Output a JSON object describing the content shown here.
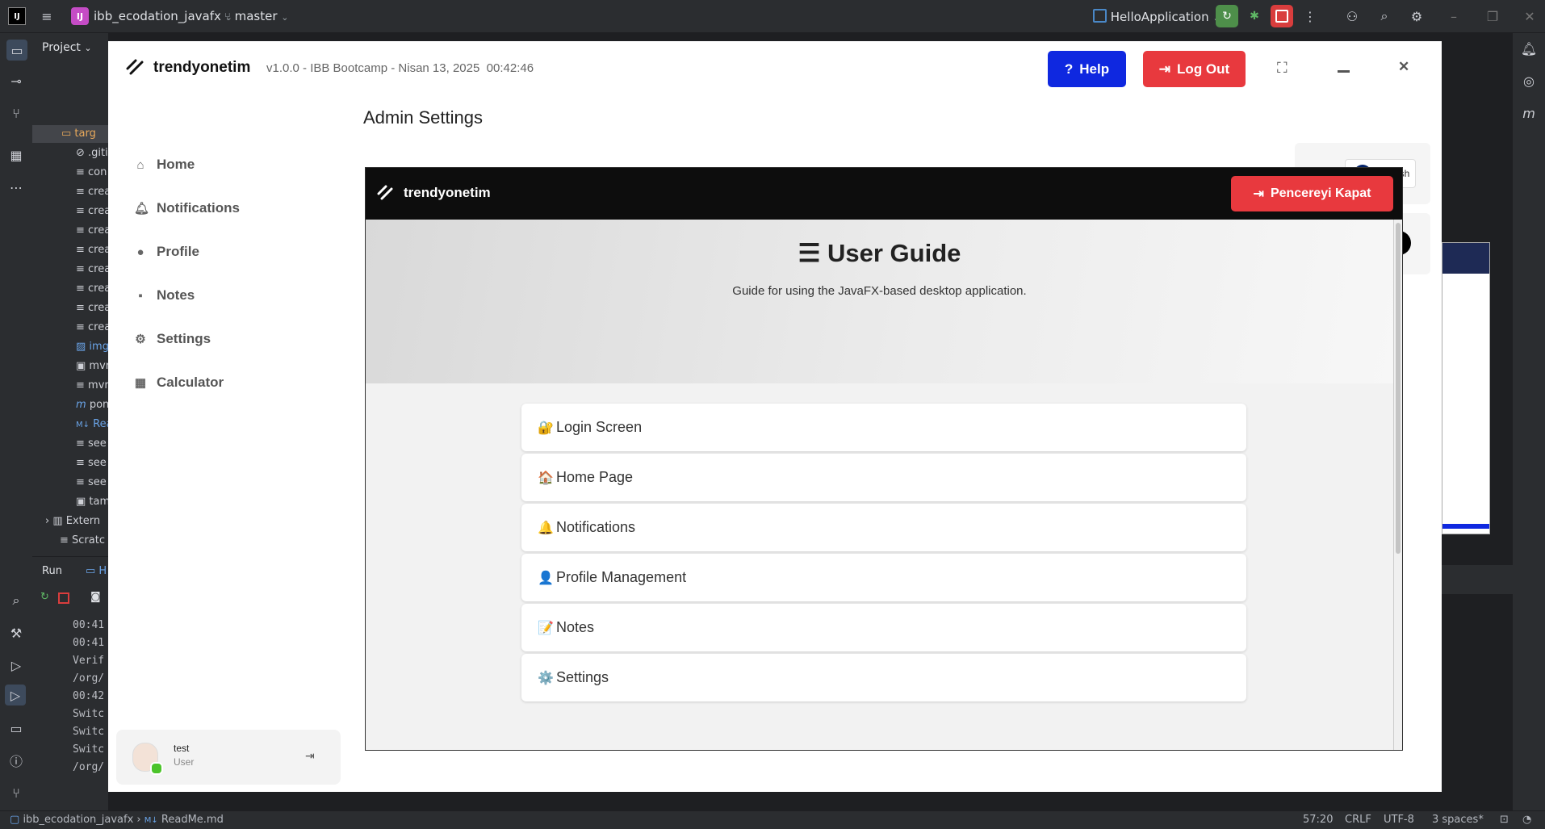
{
  "ide": {
    "project_name": "ibb_ecodation_javafx",
    "project_badge": "IJ",
    "branch": "master",
    "run_config": "HelloApplication",
    "project_panel_label": "Project",
    "tree": [
      "targ",
      ".giti",
      "con",
      "crea",
      "crea",
      "crea",
      "crea",
      "crea",
      "crea",
      "crea",
      "crea",
      "img",
      "mvr",
      "mvr",
      "pon",
      "Rea",
      "see",
      "see",
      "see",
      "tam",
      "Extern",
      "Scratc"
    ],
    "run_tab": "Run",
    "run_tab2": "H",
    "console_lines": [
      "00:41",
      "00:41",
      "Verif",
      "/org/",
      "00:42",
      "Switc",
      "Switc",
      "Switc",
      "/org/"
    ],
    "status": {
      "breadcrumb_project": "ibb_ecodation_javafx",
      "breadcrumb_file": "ReadMe.md",
      "position": "57:20",
      "line_sep": "CRLF",
      "encoding": "UTF-8",
      "indent": "3 spaces*"
    }
  },
  "app": {
    "brand": "trendyonetim",
    "version_info": "v1.0.0 - IBB Bootcamp - Nisan 13, 2025",
    "clock": "00:42:46",
    "help_label": "Help",
    "logout_label": "Log Out",
    "nav": [
      {
        "label": "Home",
        "icon": "home-icon"
      },
      {
        "label": "Notifications",
        "icon": "bell-icon"
      },
      {
        "label": "Profile",
        "icon": "user-icon"
      },
      {
        "label": "Notes",
        "icon": "note-icon"
      },
      {
        "label": "Settings",
        "icon": "gear-icon"
      },
      {
        "label": "Calculator",
        "icon": "calculator-icon"
      }
    ],
    "page_title": "Admin Settings",
    "language": "English",
    "user": {
      "name": "test",
      "role": "User"
    }
  },
  "modal": {
    "brand": "trendyonetim",
    "close_label": "Pencereyi Kapat",
    "title": "User Guide",
    "subtitle": "Guide for using the JavaFX-based desktop application.",
    "sections": [
      {
        "label": "Login Screen",
        "icon": "🔐"
      },
      {
        "label": "Home Page",
        "icon": "🏠"
      },
      {
        "label": "Notifications",
        "icon": "🔔"
      },
      {
        "label": "Profile Management",
        "icon": "👤"
      },
      {
        "label": "Notes",
        "icon": "📝"
      },
      {
        "label": "Settings",
        "icon": "⚙️"
      }
    ]
  },
  "colors": {
    "help": "#0f28e0",
    "logout": "#e8393e",
    "modal_header": "#0d0d0d"
  }
}
